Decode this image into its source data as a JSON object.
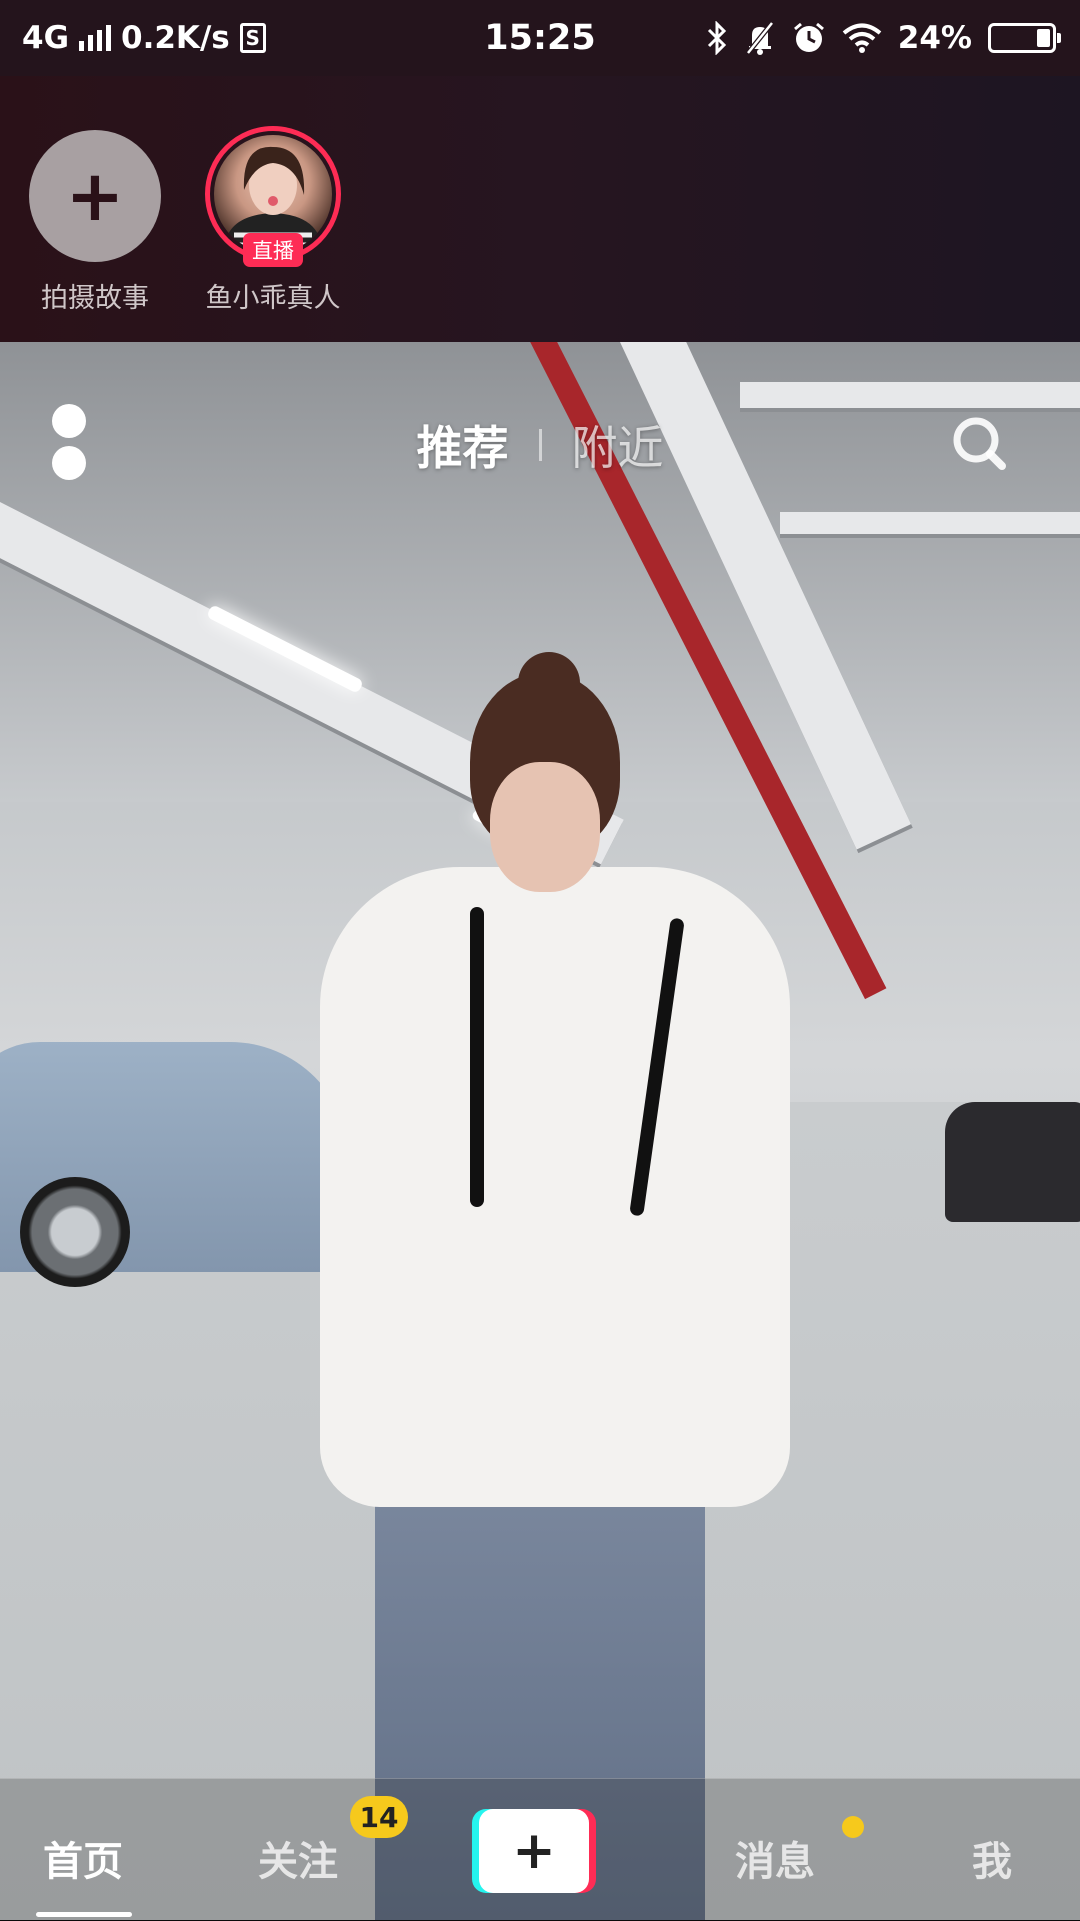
{
  "status_bar": {
    "network": "4G",
    "speed": "0.2K/s",
    "sim_icon": "S",
    "time": "15:25",
    "battery": "24%",
    "battery_level": 0.24,
    "icons": [
      "signal-icon",
      "sim-icon",
      "bluetooth-icon",
      "mute-bell-icon",
      "alarm-icon",
      "wifi-icon",
      "battery-icon"
    ]
  },
  "stories": [
    {
      "label": "拍摄故事",
      "type": "create",
      "icon": "plus-icon"
    },
    {
      "label": "鱼小乖真人",
      "type": "live",
      "badge": "直播"
    }
  ],
  "top_tabs": {
    "active": "推荐",
    "inactive": "附近",
    "icons": [
      "menu-dots-icon",
      "search-icon"
    ]
  },
  "bottom_nav": {
    "items": [
      {
        "label": "首页",
        "active": true
      },
      {
        "label": "关注",
        "badge": "14"
      },
      {
        "label": "+",
        "type": "create"
      },
      {
        "label": "消息",
        "dot": true
      },
      {
        "label": "我"
      }
    ]
  },
  "colors": {
    "accent_pink": "#fe2c55",
    "accent_cyan": "#25f4ee",
    "badge_yellow": "#f6c91c",
    "header_bg": "#24141c"
  }
}
